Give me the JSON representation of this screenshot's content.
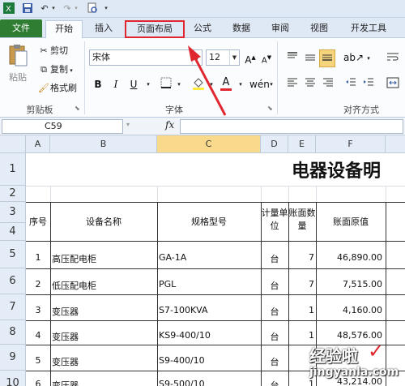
{
  "quick_access": {
    "save_icon": "save-icon",
    "undo_icon": "undo-icon",
    "redo_icon": "redo-icon",
    "print_preview_icon": "print-preview-icon",
    "customize_icon": "customize-toolbar-icon"
  },
  "tabs": [
    {
      "label": "文件"
    },
    {
      "label": "开始"
    },
    {
      "label": "插入"
    },
    {
      "label": "页面布局"
    },
    {
      "label": "公式"
    },
    {
      "label": "数据"
    },
    {
      "label": "审阅"
    },
    {
      "label": "视图"
    },
    {
      "label": "开发工具"
    }
  ],
  "ribbon": {
    "clipboard": {
      "paste": "粘贴",
      "cut": "剪切",
      "copy": "复制",
      "format_painter": "格式刷",
      "group_label": "剪贴板"
    },
    "font": {
      "font_name": "宋体",
      "font_size": "12",
      "bold": "B",
      "italic": "I",
      "underline": "U",
      "group_label": "字体"
    },
    "alignment": {
      "group_label": "对齐方式"
    }
  },
  "formula_bar": {
    "name_box": "C59",
    "fx": "fx",
    "formula": ""
  },
  "grid": {
    "columns": [
      "A",
      "B",
      "C",
      "D",
      "E",
      "F"
    ],
    "selected_column": "C",
    "rows": [
      "1",
      "2",
      "3",
      "4",
      "5",
      "6",
      "7",
      "8",
      "9",
      "10"
    ],
    "title": "电器设备明",
    "headers": {
      "seq": "序号",
      "name": "设备名称",
      "model": "规格型号",
      "unit": "计量单位",
      "qty": "账面数量",
      "value": "账面原值"
    },
    "data_rows": [
      {
        "seq": "1",
        "name": "高压配电柜",
        "model": "GA-1A",
        "unit": "台",
        "qty": "7",
        "value": "46,890.00"
      },
      {
        "seq": "2",
        "name": "低压配电柜",
        "model": "PGL",
        "unit": "台",
        "qty": "7",
        "value": "7,515.00"
      },
      {
        "seq": "3",
        "name": "变压器",
        "model": "S7-100KVA",
        "unit": "台",
        "qty": "1",
        "value": "4,160.00"
      },
      {
        "seq": "4",
        "name": "变压器",
        "model": "KS9-400/10",
        "unit": "台",
        "qty": "1",
        "value": "48,576.00"
      },
      {
        "seq": "5",
        "name": "变压器",
        "model": "S9-400/10",
        "unit": "台",
        "qty": "1",
        "value": ""
      },
      {
        "seq": "6",
        "name": "变压器",
        "model": "S9-500/10",
        "unit": "台",
        "qty": "1",
        "value": "43,214.00"
      }
    ]
  },
  "watermark": {
    "cn": "经验啦",
    "en": "jingyanla.com",
    "check": "✓"
  },
  "colors": {
    "file_tab": "#2f7d32",
    "highlight_box": "#e0262e",
    "arrow": "#e0262e",
    "selected_header": "#f9d98b"
  }
}
